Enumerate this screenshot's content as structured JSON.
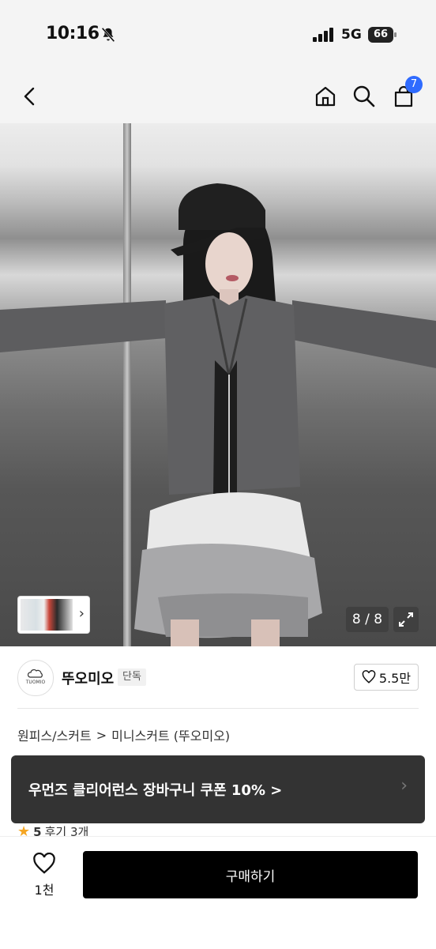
{
  "status_bar": {
    "time": "10:16",
    "network": "5G",
    "battery": "66"
  },
  "nav": {
    "cart_count": "7"
  },
  "gallery": {
    "counter": "8 / 8"
  },
  "shop": {
    "logo_text": "TUOMIO",
    "name": "뚜오미오",
    "exclusive_badge": "단독",
    "likes": "5.5만"
  },
  "breadcrumb": {
    "category": "원피스/스커트",
    "separator": ">",
    "subcategory": "미니스커트 (뚜오미오)"
  },
  "coupon_banner": {
    "text": "우먼즈 클리어런스 장바구니 쿠폰 10% >"
  },
  "rating": {
    "score": "5",
    "reviews": "후기 3개"
  },
  "bottom_bar": {
    "wish_count": "1천",
    "buy_label": "구매하기"
  },
  "colors": {
    "accent": "#2f6bff",
    "banner_bg": "#333333",
    "buy_bg": "#000000",
    "star": "#f5a623"
  }
}
